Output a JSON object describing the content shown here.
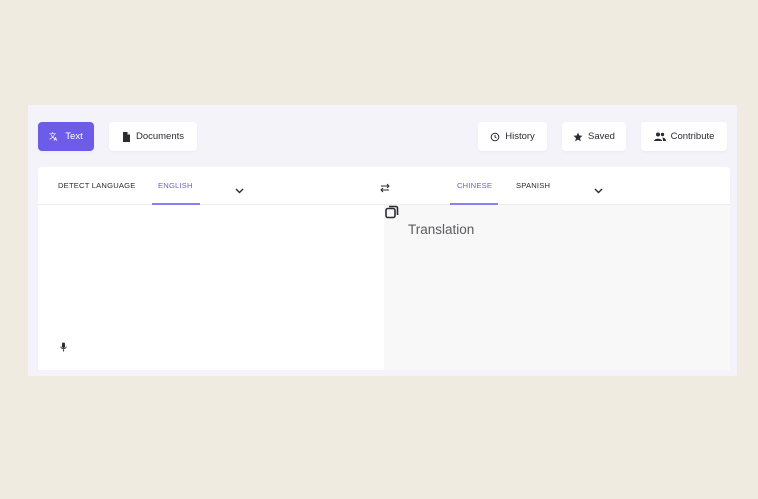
{
  "toolbar": {
    "text_label": "Text",
    "documents_label": "Documents",
    "history_label": "History",
    "saved_label": "Saved",
    "contribute_label": "Contribute"
  },
  "source_languages": {
    "detect": "DETECT LANGUAGE",
    "selected": "ENGLISH"
  },
  "target_languages": {
    "selected": "CHINESE",
    "other": "SPANISH"
  },
  "output": {
    "placeholder": "Translation"
  },
  "icons": {
    "text_tab": "translate-icon",
    "documents_tab": "document-icon",
    "history": "history-icon",
    "saved": "star-icon",
    "contribute": "people-icon",
    "source_dropdown": "chevron-down-icon",
    "target_dropdown": "chevron-down-icon",
    "swap": "swap-icon",
    "copy": "copy-icon",
    "input": "microphone-icon"
  },
  "colors": {
    "accent": "#6c5ce7",
    "page_background": "#efebe1",
    "panel_background": "#f4f3f9"
  }
}
